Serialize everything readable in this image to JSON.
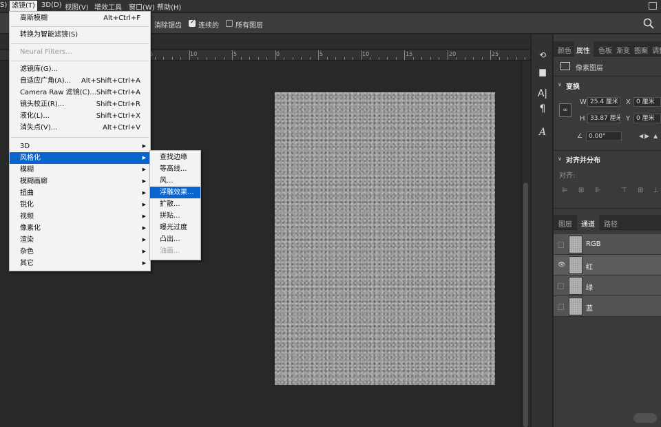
{
  "menubar": {
    "cut_left": "S)",
    "items": [
      "滤镜(T)",
      "3D(D)",
      "视图(V)",
      "增效工具",
      "窗口(W)",
      "帮助(H)"
    ]
  },
  "options": {
    "anti_alias": "消除锯齿",
    "contiguous": "连续的",
    "all_layers": "所有图层"
  },
  "ruler": [
    "15",
    "10",
    "5",
    "0",
    "5",
    "10",
    "15",
    "20",
    "25"
  ],
  "filter_menu": {
    "last_filter": {
      "label": "高斯模糊",
      "shortcut": "Alt+Ctrl+F"
    },
    "convert_smart": "转换为智能滤镜(S)",
    "neural": "Neural Filters...",
    "group1": [
      {
        "label": "滤镜库(G)...",
        "shortcut": ""
      },
      {
        "label": "自适应广角(A)...",
        "shortcut": "Alt+Shift+Ctrl+A"
      },
      {
        "label": "Camera Raw 滤镜(C)...",
        "shortcut": "Shift+Ctrl+A"
      },
      {
        "label": "镜头校正(R)...",
        "shortcut": "Shift+Ctrl+R"
      },
      {
        "label": "液化(L)...",
        "shortcut": "Shift+Ctrl+X"
      },
      {
        "label": "消失点(V)...",
        "shortcut": "Alt+Ctrl+V"
      }
    ],
    "group2": [
      "3D",
      "风格化",
      "模糊",
      "模糊画廊",
      "扭曲",
      "锐化",
      "视频",
      "像素化",
      "渲染",
      "杂色",
      "其它"
    ]
  },
  "stylize_submenu": [
    "查找边缘",
    "等高线...",
    "风...",
    "浮雕效果...",
    "扩散...",
    "拼贴...",
    "曝光过度",
    "凸出...",
    "油画..."
  ],
  "properties": {
    "tabs": [
      "颜色",
      "属性",
      "色板",
      "渐变",
      "图案",
      "调整"
    ],
    "layer_type": "像素图层",
    "transform_title": "变换",
    "w_label": "W",
    "w_value": "25.4 厘米",
    "x_label": "X",
    "x_value": "0 厘米",
    "h_label": "H",
    "h_value": "33.87 厘米",
    "y_label": "Y",
    "y_value": "0 厘米",
    "angle": "0.00°",
    "align_title": "对齐并分布",
    "align_label": "对齐:"
  },
  "channels_panel": {
    "tabs": [
      "图层",
      "通道",
      "路径"
    ],
    "channels": [
      "RGB",
      "红",
      "绿",
      "蓝"
    ]
  }
}
